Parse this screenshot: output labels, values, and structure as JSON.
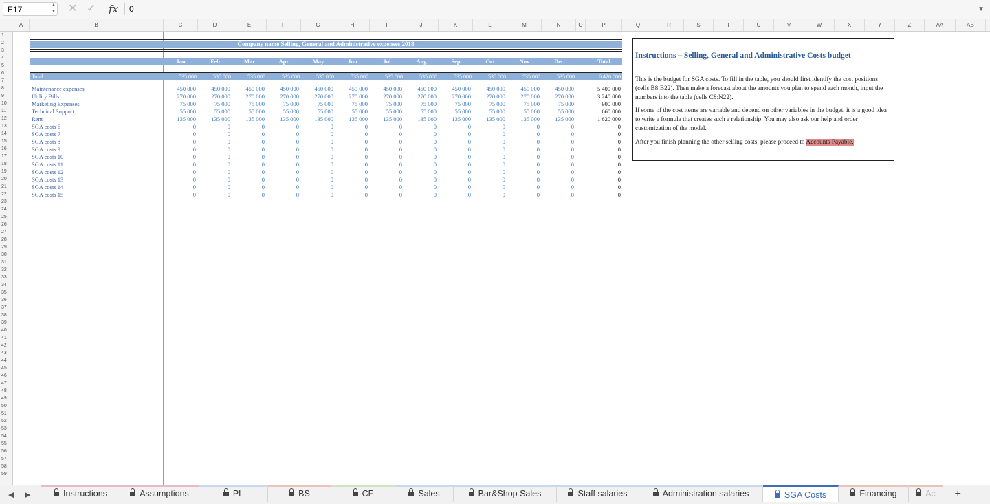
{
  "formula_bar": {
    "cell_ref": "E17",
    "formula": "0",
    "cancel_icon": "close-icon",
    "confirm_icon": "check-icon",
    "fx_label": "fx"
  },
  "columns": [
    "A",
    "B",
    "C",
    "D",
    "E",
    "F",
    "G",
    "H",
    "I",
    "J",
    "K",
    "L",
    "M",
    "N",
    "O",
    "P",
    "Q",
    "R",
    "S",
    "T",
    "U",
    "V",
    "W",
    "X",
    "Y",
    "Z",
    "AA",
    "AB"
  ],
  "sheet": {
    "title": "Company name Selling, General and Administrative expenses 2018",
    "months": [
      "Jan",
      "Feb",
      "Mar",
      "Apr",
      "May",
      "Jun",
      "Jul",
      "Aug",
      "Sep",
      "Oct",
      "Nov",
      "Dec",
      "Total"
    ],
    "total_label": "Total",
    "totals": [
      "535 000",
      "535 000",
      "535 000",
      "535 000",
      "535 000",
      "535 000",
      "535 000",
      "535 000",
      "535 000",
      "535 000",
      "535 000",
      "535 000",
      "6 420 000"
    ],
    "rows": [
      {
        "label": "Maintenance expenses",
        "values": [
          "450 000",
          "450 000",
          "450 000",
          "450 000",
          "450 000",
          "450 000",
          "450 000",
          "450 000",
          "450 000",
          "450 000",
          "450 000",
          "450 000"
        ],
        "total": "5 400 000"
      },
      {
        "label": "Utility Bills",
        "values": [
          "270 000",
          "270 000",
          "270 000",
          "270 000",
          "270 000",
          "270 000",
          "270 000",
          "270 000",
          "270 000",
          "270 000",
          "270 000",
          "270 000"
        ],
        "total": "3 240 000"
      },
      {
        "label": "Marketing Expenses",
        "values": [
          "75 000",
          "75 000",
          "75 000",
          "75 000",
          "75 000",
          "75 000",
          "75 000",
          "75 000",
          "75 000",
          "75 000",
          "75 000",
          "75 000"
        ],
        "total": "900 000"
      },
      {
        "label": "Technical Support",
        "values": [
          "55 000",
          "55 000",
          "55 000",
          "55 000",
          "55 000",
          "55 000",
          "55 000",
          "55 000",
          "55 000",
          "55 000",
          "55 000",
          "55 000"
        ],
        "total": "660 000"
      },
      {
        "label": "Rent",
        "values": [
          "135 000",
          "135 000",
          "135 000",
          "135 000",
          "135 000",
          "135 000",
          "135 000",
          "135 000",
          "135 000",
          "135 000",
          "135 000",
          "135 000"
        ],
        "total": "1 620 000"
      },
      {
        "label": "SGA costs 6",
        "values": [
          "0",
          "0",
          "0",
          "0",
          "0",
          "0",
          "0",
          "0",
          "0",
          "0",
          "0",
          "0"
        ],
        "total": "0"
      },
      {
        "label": "SGA costs 7",
        "values": [
          "0",
          "0",
          "0",
          "0",
          "0",
          "0",
          "0",
          "0",
          "0",
          "0",
          "0",
          "0"
        ],
        "total": "0"
      },
      {
        "label": "SGA costs 8",
        "values": [
          "0",
          "0",
          "0",
          "0",
          "0",
          "0",
          "0",
          "0",
          "0",
          "0",
          "0",
          "0"
        ],
        "total": "0"
      },
      {
        "label": "SGA costs 9",
        "values": [
          "0",
          "0",
          "0",
          "0",
          "0",
          "0",
          "0",
          "0",
          "0",
          "0",
          "0",
          "0"
        ],
        "total": "0"
      },
      {
        "label": "SGA costs 10",
        "values": [
          "0",
          "0",
          "0",
          "0",
          "0",
          "0",
          "0",
          "0",
          "0",
          "0",
          "0",
          "0"
        ],
        "total": "0"
      },
      {
        "label": "SGA costs 11",
        "values": [
          "0",
          "0",
          "0",
          "0",
          "0",
          "0",
          "0",
          "0",
          "0",
          "0",
          "0",
          "0"
        ],
        "total": "0"
      },
      {
        "label": "SGA costs 12",
        "values": [
          "0",
          "0",
          "0",
          "0",
          "0",
          "0",
          "0",
          "0",
          "0",
          "0",
          "0",
          "0"
        ],
        "total": "0"
      },
      {
        "label": "SGA costs 13",
        "values": [
          "0",
          "0",
          "0",
          "0",
          "0",
          "0",
          "0",
          "0",
          "0",
          "0",
          "0",
          "0"
        ],
        "total": "0"
      },
      {
        "label": "SGA costs 14",
        "values": [
          "0",
          "0",
          "0",
          "0",
          "0",
          "0",
          "0",
          "0",
          "0",
          "0",
          "0",
          "0"
        ],
        "total": "0"
      },
      {
        "label": "SGA costs 15",
        "values": [
          "0",
          "0",
          "0",
          "0",
          "0",
          "0",
          "0",
          "0",
          "0",
          "0",
          "0",
          "0"
        ],
        "total": "0"
      }
    ]
  },
  "instructions": {
    "title": "Instructions – Selling, General and Administrative Costs budget",
    "para1": "This is the budget for SGA costs. To fill in the table, you should first identify the cost positions (cells B8:B22). Then make a forecast about the amounts you plan to spend each month, input the numbers into the table (cells C8:N22).",
    "para2": "If some of the cost items are variable and depend on other variables in the budget, it is a good idea to write a formula that creates such a relationship. You may also ask our help and order customization of the model.",
    "para3_prefix": "After you finish planning the other selling costs, please proceed to ",
    "para3_link": "Accounts Payable."
  },
  "tabs": [
    {
      "label": "Instructions",
      "active": false,
      "stripe": "#e9b9c9"
    },
    {
      "label": "Assumptions",
      "active": false,
      "stripe": "#e9b9c9"
    },
    {
      "label": "PL",
      "active": false,
      "stripe": "#c9d8ef"
    },
    {
      "label": "BS",
      "active": false,
      "stripe": "#f0c0c0"
    },
    {
      "label": "CF",
      "active": false,
      "stripe": "#cfe6c0"
    },
    {
      "label": "Sales",
      "active": false,
      "stripe": "#c9d8ef"
    },
    {
      "label": "Bar&Shop Sales",
      "active": false,
      "stripe": "#c9d8ef"
    },
    {
      "label": "Staff salaries",
      "active": false,
      "stripe": "#c9d8ef"
    },
    {
      "label": "Administration salaries",
      "active": false,
      "stripe": "#c9d8ef"
    },
    {
      "label": "SGA Costs",
      "active": true,
      "stripe": "#3d6fb6"
    },
    {
      "label": "Financing",
      "active": false,
      "stripe": "#f0c0c0"
    },
    {
      "label": "Ac",
      "active": false,
      "stripe": "#f0c0c0"
    }
  ],
  "add_tab_label": "+"
}
